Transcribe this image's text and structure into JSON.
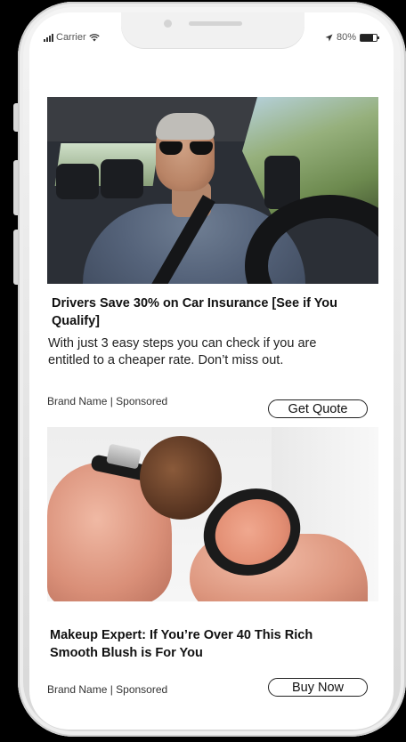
{
  "status_bar": {
    "carrier": "Carrier",
    "battery": "80%"
  },
  "ads": [
    {
      "title": "Drivers Save 30% on Car Insurance [See if You Qualify]",
      "description": "With just 3 easy steps you can check if you are entitled to a cheaper rate. Don’t miss out.",
      "meta": "Brand Name | Sponsored",
      "cta": "Get Quote"
    },
    {
      "title": "Makeup Expert: If You’re Over 40 This Rich Smooth  Blush is For You",
      "description": "",
      "meta": "Brand Name | Sponsored",
      "cta": "Buy Now"
    }
  ],
  "colors": {
    "frame": "#e6e6e6",
    "screen": "#ffffff",
    "text": "#111111"
  }
}
